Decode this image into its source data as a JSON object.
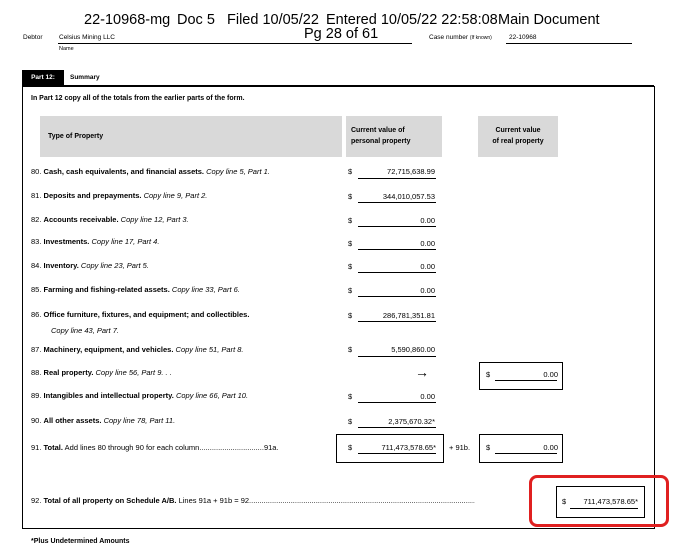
{
  "header": {
    "case_line": "22-10968-mg",
    "doc": "Doc 5",
    "filed": "Filed 10/05/22",
    "entered": "Entered 10/05/22 22:58:08",
    "main_doc": "Main Document",
    "page": "Pg 28 of 61"
  },
  "debtor": {
    "label": "Debtor",
    "name": "Celsius Mining LLC",
    "name_caption": "Name",
    "case_label": "Case number",
    "case_label_small": "(If known)",
    "case_number": "22-10968"
  },
  "part": {
    "tab": "Part 12:",
    "title": "Summary",
    "instruction": "In Part 12 copy all of the totals from the earlier parts of the form."
  },
  "columns": {
    "type": "Type of Property",
    "personal_1": "Current value of",
    "personal_2": "personal property",
    "real_1": "Current value",
    "real_2": "of real property"
  },
  "rows": [
    {
      "num": "80.",
      "bold": "Cash, cash equivalents, and financial assets.",
      "ital": "Copy line 5, Part 1.",
      "dollar": "$",
      "amount": "72,715,638.99"
    },
    {
      "num": "81.",
      "bold": "Deposits and prepayments.",
      "ital": "Copy line 9, Part 2.",
      "dollar": "$",
      "amount": "344,010,057.53"
    },
    {
      "num": "82.",
      "bold": "Accounts receivable.",
      "ital": "Copy line 12, Part 3.",
      "dollar": "$",
      "amount": "0.00"
    },
    {
      "num": "83.",
      "bold": "Investments.",
      "ital": "Copy line 17, Part 4.",
      "dollar": "$",
      "amount": "0.00"
    },
    {
      "num": "84.",
      "bold": "Inventory.",
      "ital": "Copy line 23, Part 5.",
      "dollar": "$",
      "amount": "0.00"
    },
    {
      "num": "85.",
      "bold": "Farming and fishing-related assets.",
      "ital": "Copy line 33, Part 6.",
      "dollar": "$",
      "amount": "0.00"
    },
    {
      "num": "86.",
      "bold": "Office furniture, fixtures, and equipment; and collectibles.",
      "ital": "Copy line 43, Part 7.",
      "dollar": "$",
      "amount": "286,781,351.81"
    },
    {
      "num": "87.",
      "bold": "Machinery, equipment, and vehicles.",
      "ital": "Copy line 51, Part 8.",
      "dollar": "$",
      "amount": "5,590,860.00"
    },
    {
      "num": "88.",
      "bold": "Real property.",
      "ital": "Copy line 56, Part 9. . .",
      "dollar": "",
      "amount": ""
    },
    {
      "num": "89.",
      "bold": "Intangibles and intellectual property.",
      "ital": "Copy line 66, Part 10.",
      "dollar": "$",
      "amount": "0.00"
    },
    {
      "num": "90.",
      "bold": "All other assets.",
      "ital": "Copy line 78, Part 11.",
      "dollar": "$",
      "amount": "2,375,670.32*"
    }
  ],
  "real_property": {
    "arrow": "→",
    "dollar": "$",
    "amount": "0.00"
  },
  "total": {
    "num": "91.",
    "bold": "Total.",
    "text": "Add lines 80 through 90 for each column",
    "dots": "...............................",
    "code_a": "91a.",
    "dollar_a": "$",
    "amount_a": "711,473,578.65*",
    "plus": "+ 91b.",
    "dollar_b": "$",
    "amount_b": "0.00"
  },
  "grand_total": {
    "num": "92.",
    "bold": "Total of all property on Schedule A/B.",
    "text": "Lines 91a + 91b = 92",
    "dots": ".....................................................................................................................................................................",
    "dollar": "$",
    "amount": "711,473,578.65*"
  },
  "footnote": "*Plus Undetermined Amounts"
}
